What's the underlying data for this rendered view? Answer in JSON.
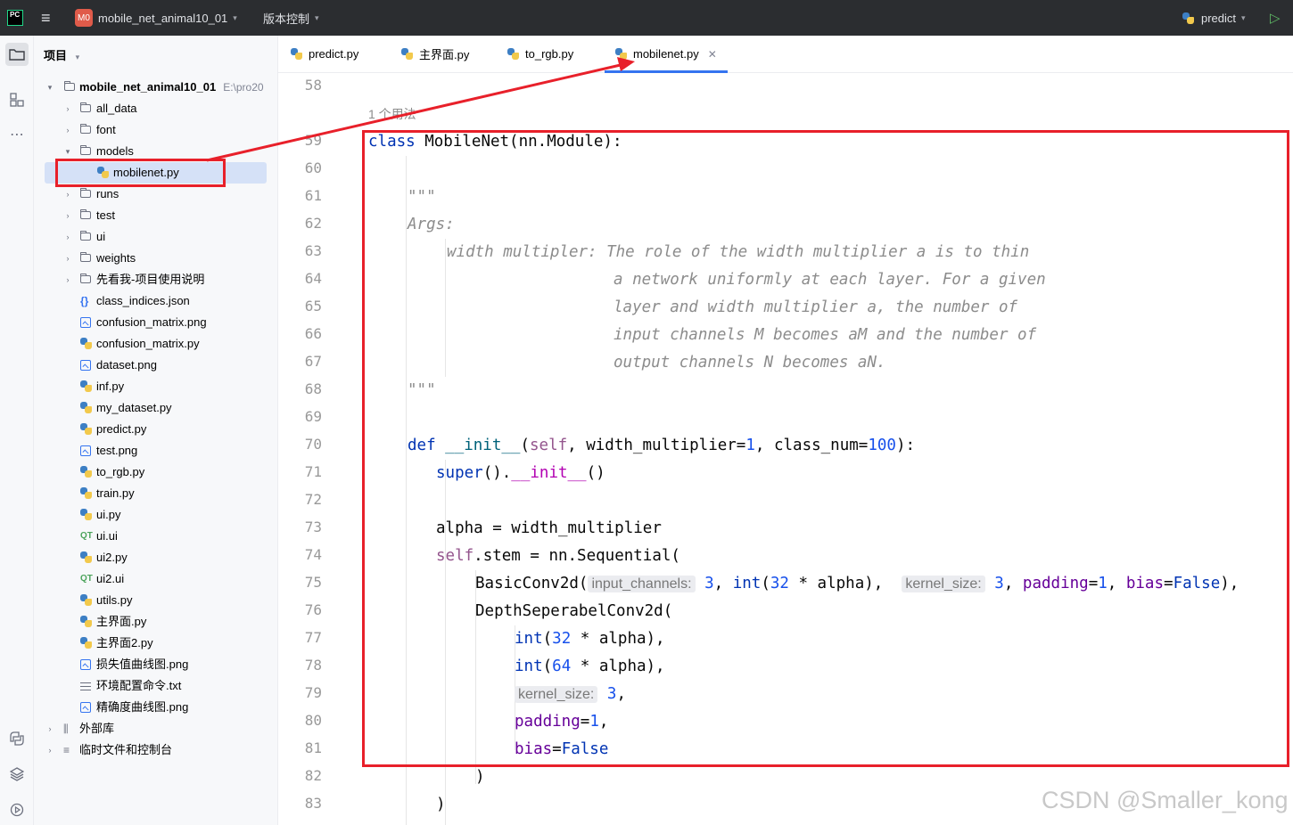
{
  "titlebar": {
    "logo": "PC",
    "project_badge": "M0",
    "project_name": "mobile_net_animal10_01",
    "vcs": "版本控制",
    "run_config": "predict"
  },
  "panel": {
    "title": "项目",
    "root": {
      "name": "mobile_net_animal10_01",
      "path": "E:\\pro20"
    },
    "items": [
      {
        "name": "all_data",
        "type": "folder",
        "expanded": false
      },
      {
        "name": "font",
        "type": "folder",
        "expanded": false
      },
      {
        "name": "models",
        "type": "folder",
        "expanded": true
      },
      {
        "name": "mobilenet.py",
        "type": "py",
        "child": true,
        "selected": true
      },
      {
        "name": "runs",
        "type": "folder",
        "expanded": false
      },
      {
        "name": "test",
        "type": "folder",
        "expanded": false
      },
      {
        "name": "ui",
        "type": "folder",
        "expanded": false
      },
      {
        "name": "weights",
        "type": "folder",
        "expanded": false
      },
      {
        "name": "先看我-项目使用说明",
        "type": "folder",
        "expanded": false
      },
      {
        "name": "class_indices.json",
        "type": "json"
      },
      {
        "name": "confusion_matrix.png",
        "type": "img"
      },
      {
        "name": "confusion_matrix.py",
        "type": "py"
      },
      {
        "name": "dataset.png",
        "type": "img"
      },
      {
        "name": "inf.py",
        "type": "py"
      },
      {
        "name": "my_dataset.py",
        "type": "py"
      },
      {
        "name": "predict.py",
        "type": "py"
      },
      {
        "name": "test.png",
        "type": "img"
      },
      {
        "name": "to_rgb.py",
        "type": "py"
      },
      {
        "name": "train.py",
        "type": "py"
      },
      {
        "name": "ui.py",
        "type": "py"
      },
      {
        "name": "ui.ui",
        "type": "qt"
      },
      {
        "name": "ui2.py",
        "type": "py"
      },
      {
        "name": "ui2.ui",
        "type": "qt"
      },
      {
        "name": "utils.py",
        "type": "py"
      },
      {
        "name": "主界面.py",
        "type": "py"
      },
      {
        "name": "主界面2.py",
        "type": "py"
      },
      {
        "name": "损失值曲线图.png",
        "type": "img"
      },
      {
        "name": "环境配置命令.txt",
        "type": "txt"
      },
      {
        "name": "精确度曲线图.png",
        "type": "img"
      }
    ],
    "external_libs": "外部库",
    "scratches": "临时文件和控制台"
  },
  "tabs": [
    {
      "label": "predict.py",
      "active": false
    },
    {
      "label": "主界面.py",
      "active": false
    },
    {
      "label": "to_rgb.py",
      "active": false
    },
    {
      "label": "mobilenet.py",
      "active": true
    }
  ],
  "editor": {
    "usage_hint": "1 个用法",
    "line_numbers": [
      "58",
      "59",
      "60",
      "61",
      "62",
      "63",
      "64",
      "65",
      "66",
      "67",
      "68",
      "69",
      "70",
      "71",
      "72",
      "73",
      "74",
      "75",
      "76",
      "77",
      "78",
      "79",
      "80",
      "81",
      "82",
      "83"
    ],
    "code": {
      "l59_kw": "class",
      "l59_rest": " MobileNet(nn.Module):",
      "l61": "\"\"\"",
      "l62": "Args:",
      "l63": "width multipler: The role of the width multiplier a is to thin",
      "l64": "a network uniformly at each layer. For a given",
      "l65": "layer and width multiplier a, the number of",
      "l66": "input channels M becomes aM and the number of",
      "l67": "output channels N becomes aN.",
      "l68": "\"\"\"",
      "l70_def": "def ",
      "l70_init": "__init__",
      "l70_open": "(",
      "l70_self": "self",
      "l70_a": ", width_multiplier=",
      "l70_n1": "1",
      "l70_b": ", class_num=",
      "l70_n2": "100",
      "l70_c": "):",
      "l71_super": "super",
      "l71_a": "().",
      "l71_init": "__init__",
      "l71_b": "()",
      "l73": "alpha = width_multiplier",
      "l74_self": "self",
      "l74_rest": ".stem = nn.Sequential(",
      "l75_a": "BasicConv2d(",
      "l75_hint1": "input_channels:",
      "l75_n3": "3",
      "l75_b": ", ",
      "l75_int": "int",
      "l75_c": "(",
      "l75_n32": "32",
      "l75_d": " * alpha),  ",
      "l75_hint2": "kernel_size:",
      "l75_n3b": "3",
      "l75_e": ", ",
      "l75_pad": "padding",
      "l75_f": "=",
      "l75_n1": "1",
      "l75_g": ", ",
      "l75_bias": "bias",
      "l75_h": "=",
      "l75_false": "False",
      "l75_i": "),",
      "l76": "DepthSeperabelConv2d(",
      "l77_int": "int",
      "l77_a": "(",
      "l77_n": "32",
      "l77_b": " * alpha),",
      "l78_int": "int",
      "l78_a": "(",
      "l78_n": "64",
      "l78_b": " * alpha),",
      "l79_hint": "kernel_size:",
      "l79_n": "3",
      "l79_b": ",",
      "l80_pad": "padding",
      "l80_a": "=",
      "l80_n": "1",
      "l80_b": ",",
      "l81_bias": "bias",
      "l81_a": "=",
      "l81_false": "False",
      "l82": ")",
      "l83": ")"
    }
  },
  "watermark": "CSDN @Smaller_kong",
  "colors": {
    "annotation": "#e8202a",
    "accent": "#3574f0"
  }
}
